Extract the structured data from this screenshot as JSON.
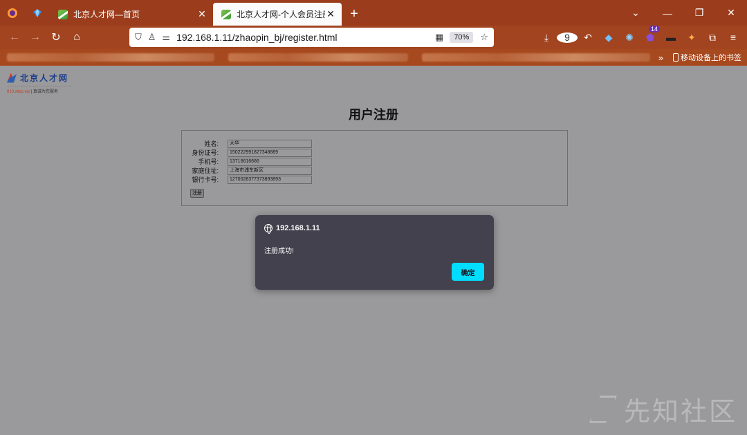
{
  "browser": {
    "tabs": [
      {
        "title": "北京人才网—首页",
        "active": false
      },
      {
        "title": "北京人才网-个人会员注册",
        "active": true
      }
    ],
    "url": "192.168.1.11/zhaopin_bj/register.html",
    "zoom": "70%",
    "download_badge": "9",
    "extension_badge": "14",
    "bookmarks_mobile_label": "移动设备上的书签"
  },
  "page": {
    "logo_name": "北京人才网",
    "logo_domain": "010.wlzp.vip",
    "logo_tagline": "| 真诚为您服务",
    "title": "用户注册",
    "form": {
      "fields": [
        {
          "label": "姓名:",
          "value": "大华"
        },
        {
          "label": "身份证号:",
          "value": "150222991827348889"
        },
        {
          "label": "手机号:",
          "value": "13716616666"
        },
        {
          "label": "家庭住址:",
          "value": "上海市浦东新区"
        },
        {
          "label": "银行卡号:",
          "value": "1270028377373893893"
        }
      ],
      "submit_label": "注册"
    }
  },
  "dialog": {
    "origin": "192.168.1.11",
    "message": "注册成功!",
    "ok_label": "确定",
    "ok_color": "#00ddff"
  },
  "watermark": "先知社区"
}
